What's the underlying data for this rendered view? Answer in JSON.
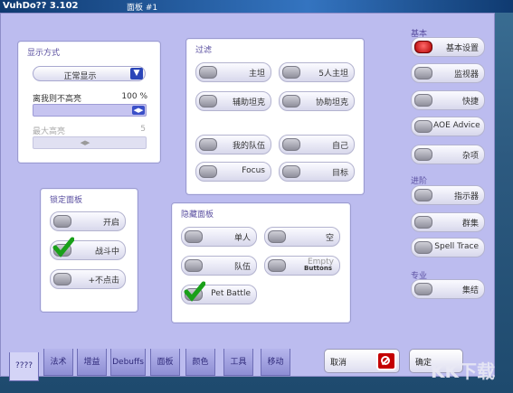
{
  "window": {
    "app_title": "VuhDo?? 3.102",
    "window_title": "面板 #1"
  },
  "display_mode": {
    "label": "显示方式",
    "dropdown_value": "正常显示",
    "slider_label": "离我则不高亮",
    "slider_value": "100 %",
    "max_label": "最大高亮",
    "max_value": "5"
  },
  "filter": {
    "label": "过滤",
    "buttons": [
      "主坦",
      "5人主坦",
      "辅助坦克",
      "协助坦克",
      "我的队伍",
      "自己",
      "Focus",
      "目标"
    ]
  },
  "lock_panel": {
    "label": "锁定面板",
    "buttons": [
      {
        "label": "开启",
        "checked": false
      },
      {
        "label": "战斗中",
        "checked": true
      },
      {
        "label": "+不点击",
        "checked": false
      }
    ]
  },
  "hide_panel": {
    "label": "隐藏面板",
    "buttons": [
      {
        "label": "单人",
        "checked": false
      },
      {
        "label": "空",
        "checked": false
      },
      {
        "label": "队伍",
        "checked": false
      },
      {
        "label": "Empty",
        "sub": "Buttons",
        "checked": false
      },
      {
        "label": "Pet Battle",
        "checked": true
      }
    ]
  },
  "sidebar": {
    "basic_heading": "基本",
    "basic": [
      "基本设置",
      "监视器",
      "快捷",
      "AOE Advice",
      "杂项"
    ],
    "advanced_heading": "进阶",
    "advanced": [
      "指示器",
      "群集",
      "Spell Trace"
    ],
    "pro_heading": "专业",
    "pro": [
      "集结"
    ]
  },
  "tabs": [
    "????",
    "法术",
    "增益",
    "Debuffs",
    "面板",
    "颜色",
    "工具",
    "移动"
  ],
  "footer": {
    "cancel": "取消",
    "ok": "确定",
    "watermark": "KK下载"
  },
  "colors": {
    "dialog_bg": "#bcbcef",
    "panel_bg": "#ffffff",
    "accent": "#2a45b8",
    "selected_knob": "#cc0000"
  }
}
